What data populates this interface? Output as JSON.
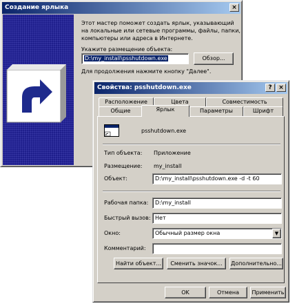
{
  "wizard": {
    "title": "Создание ярлыка",
    "description": [
      "Этот мастер поможет создать ярлык, указывающий",
      "на локальные или сетевые программы, файлы, папки,",
      "компьютеры или адреса в Интернете."
    ],
    "location_label": "Укажите размещение объекта:",
    "location_value": "D:\\my_install\\psshutdown.exe",
    "browse_button": "Обзор...",
    "continue_text": "Для продолжения нажмите кнопку \"Далее\"."
  },
  "props": {
    "title": "Свойства: psshutdown.exe",
    "title_buttons": [
      "?",
      "×"
    ],
    "tabs_back": [
      "Расположение",
      "Цвета",
      "Совместимость"
    ],
    "tabs_front": [
      "Общие",
      "Ярлык",
      "Параметры",
      "Шрифт"
    ],
    "active_tab": "Ярлык",
    "file_name": "psshutdown.exe",
    "type_label": "Тип объекта:",
    "type_value": "Приложение",
    "location_label": "Размещение:",
    "location_value": "my_install",
    "target_label": "Объект:",
    "target_value": "D:\\my_install\\psshutdown.exe -d -t 60",
    "workdir_label": "Рабочая папка:",
    "workdir_value": "D:\\my_install",
    "hotkey_label": "Быстрый вызов:",
    "hotkey_value": "Нет",
    "window_label": "Окно:",
    "window_value": "Обычный размер окна",
    "comment_label": "Комментарий:",
    "comment_value": "",
    "find_button": "Найти объект...",
    "change_icon_button": "Сменить значок...",
    "advanced_button": "Дополнительно...",
    "ok_button": "OK",
    "cancel_button": "Отмена",
    "apply_button": "Применить"
  }
}
